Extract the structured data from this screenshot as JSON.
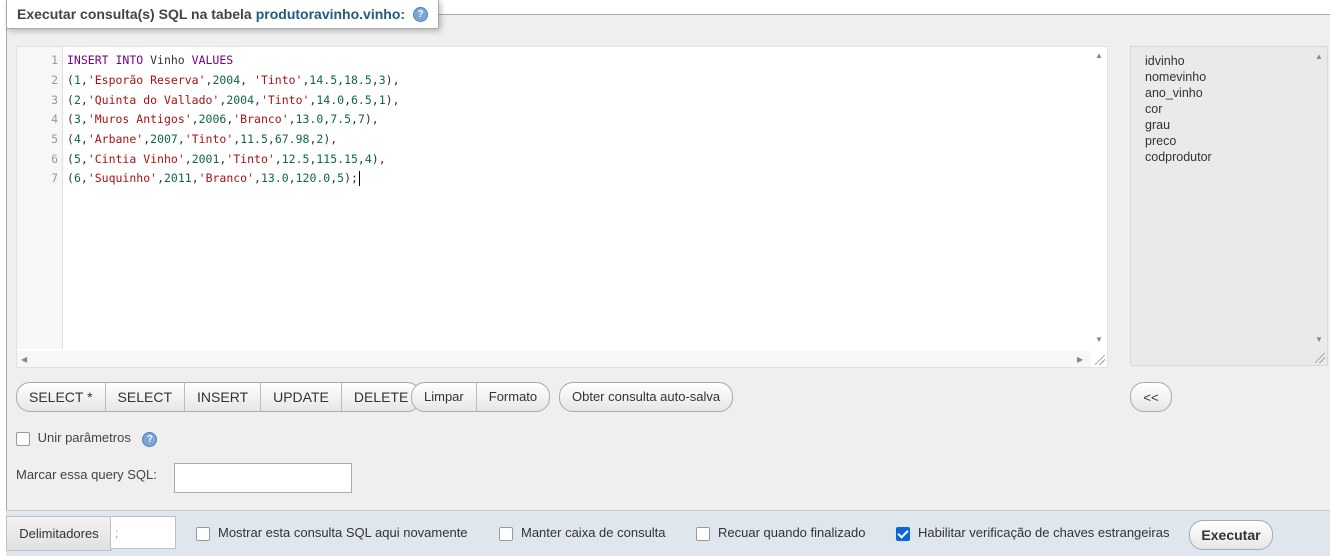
{
  "legend": {
    "prefix": "Executar consulta(s) SQL na tabela",
    "table": "produtoravinho.vinho:"
  },
  "editor": {
    "line_numbers": [
      "1",
      "2",
      "3",
      "4",
      "5",
      "6",
      "7"
    ],
    "lines": [
      "INSERT INTO Vinho VALUES",
      "(1,'Esporão Reserva',2004, 'Tinto',14.5,18.5,3),",
      "(2,'Quinta do Vallado',2004,'Tinto',14.0,6.5,1),",
      "(3,'Muros Antigos',2006,'Branco',13.0,7.5,7),",
      "(4,'Arbane',2007,'Tinto',11.5,67.98,2),",
      "(5,'Cintia Vinho',2001,'Tinto',12.5,115.15,4),",
      "(6,'Suquinho',2011,'Branco',13.0,120.0,5);"
    ]
  },
  "columns": [
    "idvinho",
    "nomevinho",
    "ano_vinho",
    "cor",
    "grau",
    "preco",
    "codprodutor"
  ],
  "buttons": {
    "select_star": "SELECT *",
    "select": "SELECT",
    "insert": "INSERT",
    "update": "UPDATE",
    "delete": "DELETE",
    "clear": "Limpar",
    "format": "Formato",
    "autosave": "Obter consulta auto-salva",
    "collapse": "<<",
    "execute": "Executar"
  },
  "bind_params": {
    "label": "Unir parâmetros",
    "checked": false
  },
  "bookmark": {
    "label": "Marcar essa query SQL:",
    "value": ""
  },
  "delimiter": {
    "label": "Delimitadores",
    "value": ";"
  },
  "options": [
    {
      "label": "Mostrar esta consulta SQL aqui novamente",
      "checked": false
    },
    {
      "label": "Manter caixa de consulta",
      "checked": false
    },
    {
      "label": "Recuar quando finalizado",
      "checked": false
    },
    {
      "label": "Habilitar verificação de chaves estrangeiras",
      "checked": true
    }
  ],
  "colors": {
    "keyword": "#770088",
    "string": "#aa1111",
    "number": "#116644",
    "link": "#235a81",
    "accent": "#0b67d6"
  },
  "icons": {
    "help": "help-icon"
  }
}
